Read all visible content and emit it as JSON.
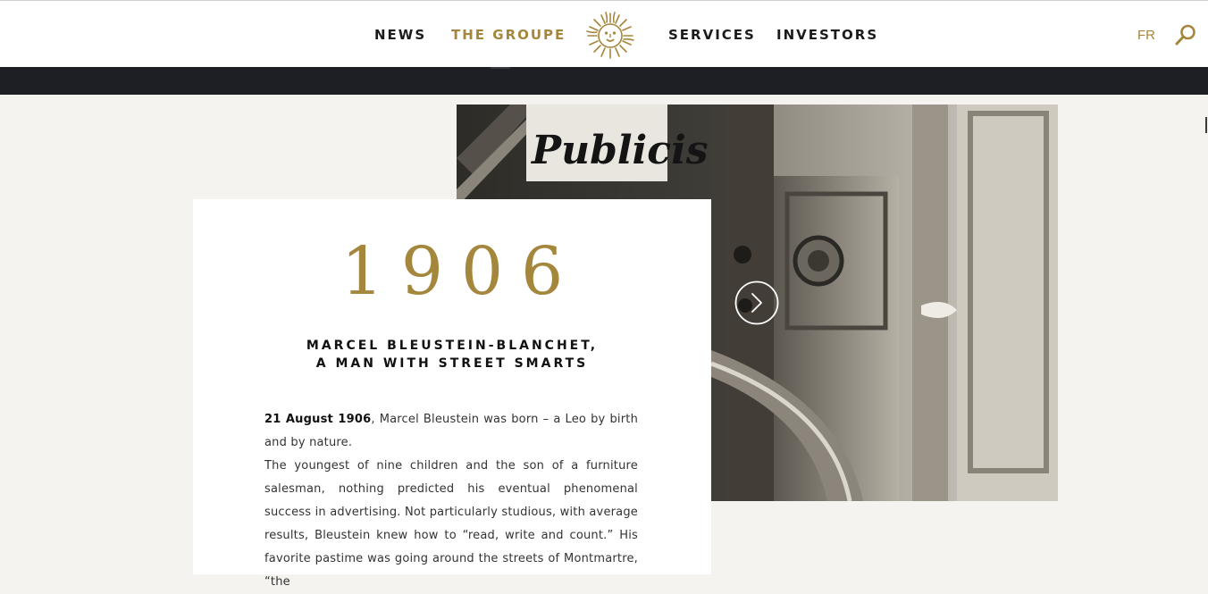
{
  "nav": {
    "news": "NEWS",
    "groupe": "THE GROUPE",
    "services": "SERVICES",
    "investors": "INVESTORS",
    "lang": "FR"
  },
  "photo": {
    "sign": "Publicis"
  },
  "entry": {
    "year": "1906",
    "headline_line1": "MARCEL BLEUSTEIN-BLANCHET,",
    "headline_line2": "A MAN WITH STREET SMARTS",
    "para1_date": "21 August 1906",
    "para1_rest": ", Marcel Bleustein was born – a Leo by birth and by nature.",
    "para2": "The youngest of nine children and the son of a furniture salesman, nothing predicted his eventual phenomenal success in advertising. Not particularly studious, with average results, Bleustein knew how to “read, write and count.” His favorite pastime was going around the streets of Montmartre, “the"
  },
  "colors": {
    "accent": "#a4873c",
    "band": "#1e1f25",
    "page_bg": "#f4f3ef"
  },
  "icons": {
    "logo": "sun-lion-logo",
    "search": "search-icon",
    "next": "chevron-right-icon"
  }
}
